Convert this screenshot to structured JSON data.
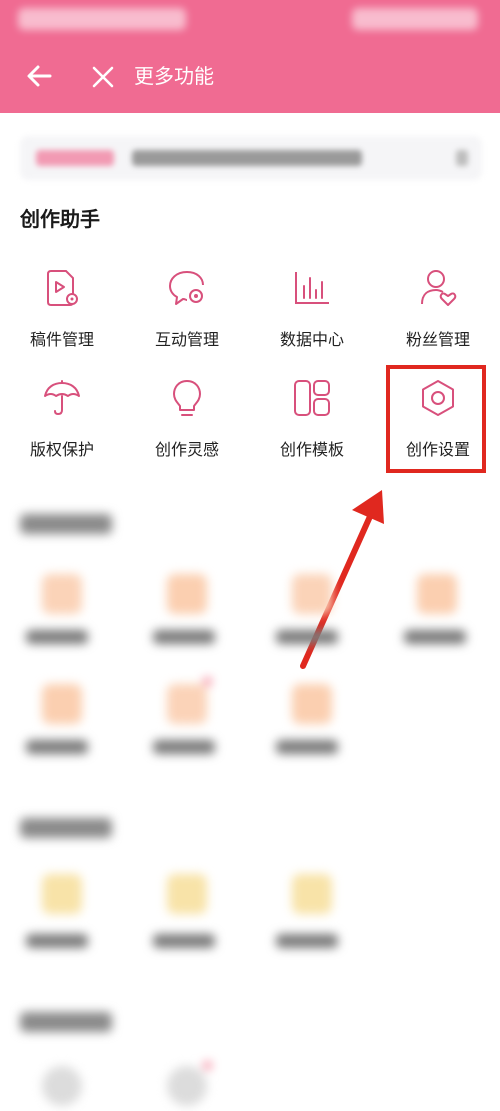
{
  "nav": {
    "title": "更多功能",
    "back_icon": "back-arrow-icon",
    "close_icon": "close-icon"
  },
  "section": {
    "title": "创作助手"
  },
  "tools": [
    {
      "label": "稿件管理",
      "icon": "manuscript-icon"
    },
    {
      "label": "互动管理",
      "icon": "interaction-icon"
    },
    {
      "label": "数据中心",
      "icon": "data-chart-icon"
    },
    {
      "label": "粉丝管理",
      "icon": "fans-icon"
    },
    {
      "label": "版权保护",
      "icon": "umbrella-icon"
    },
    {
      "label": "创作灵感",
      "icon": "lightbulb-icon"
    },
    {
      "label": "创作模板",
      "icon": "template-icon"
    },
    {
      "label": "创作设置",
      "icon": "settings-hexagon-icon"
    }
  ],
  "colors": {
    "header": "#f06b92",
    "icon_accent": "#d8507c",
    "highlight": "#e0281f"
  }
}
